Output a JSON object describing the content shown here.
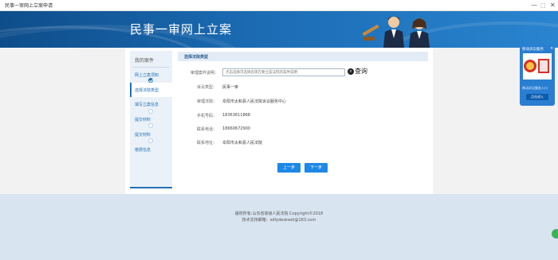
{
  "window": {
    "title": "民事一审网上立案申请",
    "controls": {
      "minimize": "—",
      "maximize": "⬚",
      "close": "✕"
    }
  },
  "banner": {
    "site_title": "民事一审网上立案"
  },
  "sidebar": {
    "heading": "我的案件",
    "steps": [
      {
        "label": "网上立案须知",
        "status": "done"
      },
      {
        "label": "选择法院类型",
        "status": "active"
      },
      {
        "label": "填写立案信息",
        "status": "pending"
      },
      {
        "label": "提交材料",
        "status": "pending"
      },
      {
        "label": "提交材料",
        "status": "pending"
      },
      {
        "label": "缴费信息",
        "status": "pending"
      }
    ]
  },
  "section": {
    "title": "选择法院类型"
  },
  "form": {
    "case_label": "审理案件说明：",
    "case_placeholder": "点击选择可选择您现在要立案法院的案件说明",
    "query_label": "查询",
    "rows": [
      {
        "label": "诉讼类型：",
        "value": "民事一审"
      },
      {
        "label": "审理法院：",
        "value": "阜阳市太和县人民法院诉讼服务中心"
      },
      {
        "label": "手机号码：",
        "value": "18363611868"
      },
      {
        "label": "联系电话：",
        "value": "18660672900"
      },
      {
        "label": "联系地址：",
        "value": "阜阳市太和县人民法院"
      }
    ]
  },
  "buttons": {
    "prev": "上一步",
    "next": "下一步"
  },
  "footer": {
    "line1": "版权所有:山东省高级人民法院 Copyright©2018",
    "line2": "技术支持邮箱：sdfydeskwzt@163.com"
  },
  "float_panel": {
    "title": "移动诉讼服务",
    "close": "×",
    "subtitle": "移动诉讼服务入口",
    "button": "点击进入"
  },
  "colors": {
    "brand_blue": "#1f6fb5",
    "button_blue": "#1e88e5",
    "footer_bg": "#d9e4f1"
  }
}
